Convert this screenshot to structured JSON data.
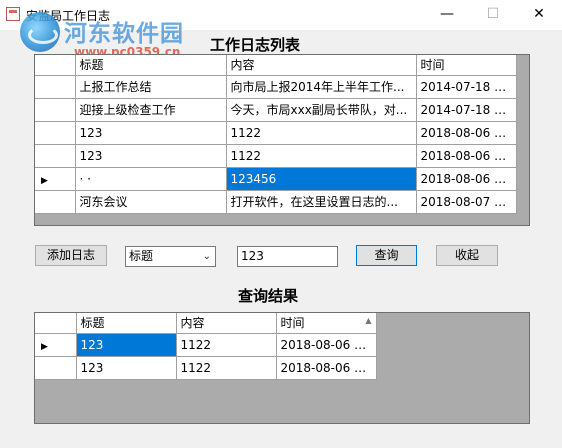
{
  "window": {
    "title": "安监局工作日志",
    "minimize_glyph": "—",
    "maximize_glyph": "☐",
    "close_glyph": "✕"
  },
  "watermark": {
    "text": "河东软件园",
    "url": "www.pc0359.cn"
  },
  "log_list": {
    "title": "工作日志列表",
    "columns": [
      "标题",
      "内容",
      "时间"
    ],
    "rows": [
      {
        "title": "上报工作总结",
        "content": "向市局上报2014年上半年工作...",
        "time": "2014-07-18 2..."
      },
      {
        "title": "迎接上级检查工作",
        "content": "今天，市局xxx副局长带队，对...",
        "time": "2014-07-18 2..."
      },
      {
        "title": "123",
        "content": "1122",
        "time": "2018-08-06 1..."
      },
      {
        "title": "123",
        "content": "1122",
        "time": "2018-08-06 1..."
      },
      {
        "title": "· ·",
        "content": "123456",
        "time": "2018-08-06 1..."
      },
      {
        "title": "河东会议",
        "content": "打开软件，在这里设置日志的...",
        "time": "2018-08-07 1..."
      }
    ],
    "current_row_marker": "▶"
  },
  "toolbar": {
    "add_label": "添加日志",
    "field_select": "标题",
    "search_value": "123",
    "query_label": "查询",
    "collapse_label": "收起"
  },
  "results": {
    "title": "查询结果",
    "columns": [
      "标题",
      "内容",
      "时间"
    ],
    "rows": [
      {
        "title": "123",
        "content": "1122",
        "time": "2018-08-06 1..."
      },
      {
        "title": "123",
        "content": "1122",
        "time": "2018-08-06 1..."
      }
    ],
    "current_row_marker": "▶",
    "sort_indicator": "▲"
  },
  "colors": {
    "selection": "#0078d7",
    "grid_background": "#ababab"
  }
}
